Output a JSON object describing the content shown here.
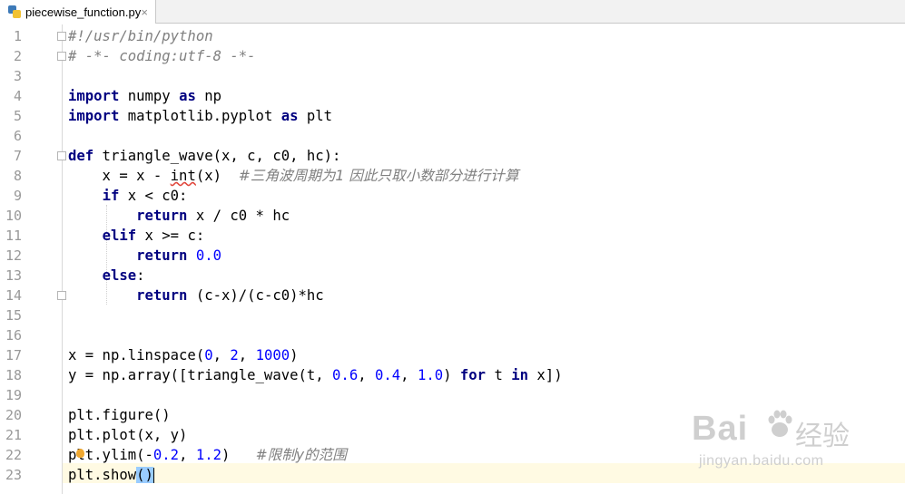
{
  "tab": {
    "filename": "piecewise_function.py",
    "close": "×"
  },
  "lines": [
    {
      "n": "1",
      "segs": [
        {
          "t": "#!/usr/bin/python",
          "c": "cm"
        }
      ]
    },
    {
      "n": "2",
      "segs": [
        {
          "t": "# -*- coding:utf-8 -*-",
          "c": "cm"
        }
      ]
    },
    {
      "n": "3",
      "segs": []
    },
    {
      "n": "4",
      "segs": [
        {
          "t": "import",
          "c": "kw"
        },
        {
          "t": " numpy "
        },
        {
          "t": "as",
          "c": "kw"
        },
        {
          "t": " np"
        }
      ]
    },
    {
      "n": "5",
      "segs": [
        {
          "t": "import",
          "c": "kw"
        },
        {
          "t": " matplotlib.pyplot "
        },
        {
          "t": "as",
          "c": "kw"
        },
        {
          "t": " plt"
        }
      ]
    },
    {
      "n": "6",
      "segs": []
    },
    {
      "n": "7",
      "segs": [
        {
          "t": "def",
          "c": "kw"
        },
        {
          "t": " triangle_wave(x, c, c0, hc):"
        }
      ]
    },
    {
      "n": "8",
      "segs": [
        {
          "t": "    x = x - "
        },
        {
          "t": "int",
          "c": "squig"
        },
        {
          "t": "(x)  "
        },
        {
          "t": "#三角波周期为1 因此只取小数部分进行计算",
          "c": "cmz"
        }
      ]
    },
    {
      "n": "9",
      "segs": [
        {
          "t": "    "
        },
        {
          "t": "if",
          "c": "kw"
        },
        {
          "t": " x < c0:"
        }
      ]
    },
    {
      "n": "10",
      "segs": [
        {
          "t": "        "
        },
        {
          "t": "return",
          "c": "kw"
        },
        {
          "t": " x / c0 * hc"
        }
      ]
    },
    {
      "n": "11",
      "segs": [
        {
          "t": "    "
        },
        {
          "t": "elif",
          "c": "kw"
        },
        {
          "t": " x >= c:"
        }
      ]
    },
    {
      "n": "12",
      "segs": [
        {
          "t": "        "
        },
        {
          "t": "return",
          "c": "kw"
        },
        {
          "t": " "
        },
        {
          "t": "0.0",
          "c": "num"
        }
      ]
    },
    {
      "n": "13",
      "segs": [
        {
          "t": "    "
        },
        {
          "t": "else",
          "c": "kw"
        },
        {
          "t": ":"
        }
      ]
    },
    {
      "n": "14",
      "segs": [
        {
          "t": "        "
        },
        {
          "t": "return",
          "c": "kw"
        },
        {
          "t": " (c-x)/(c-c0)*hc"
        }
      ]
    },
    {
      "n": "15",
      "segs": []
    },
    {
      "n": "16",
      "segs": []
    },
    {
      "n": "17",
      "segs": [
        {
          "t": "x = np.linspace("
        },
        {
          "t": "0",
          "c": "num"
        },
        {
          "t": ", "
        },
        {
          "t": "2",
          "c": "num"
        },
        {
          "t": ", "
        },
        {
          "t": "1000",
          "c": "num"
        },
        {
          "t": ")"
        }
      ]
    },
    {
      "n": "18",
      "segs": [
        {
          "t": "y = np.array([triangle_wave(t, "
        },
        {
          "t": "0.6",
          "c": "num"
        },
        {
          "t": ", "
        },
        {
          "t": "0.4",
          "c": "num"
        },
        {
          "t": ", "
        },
        {
          "t": "1.0",
          "c": "num"
        },
        {
          "t": ") "
        },
        {
          "t": "for",
          "c": "kw"
        },
        {
          "t": " t "
        },
        {
          "t": "in",
          "c": "kw"
        },
        {
          "t": " x])"
        }
      ]
    },
    {
      "n": "19",
      "segs": []
    },
    {
      "n": "20",
      "segs": [
        {
          "t": "plt.figure()"
        }
      ]
    },
    {
      "n": "21",
      "segs": [
        {
          "t": "plt.plot(x, y)"
        }
      ]
    },
    {
      "n": "22",
      "segs": [
        {
          "t": "plt.ylim(-"
        },
        {
          "t": "0.2",
          "c": "num"
        },
        {
          "t": ", "
        },
        {
          "t": "1.2",
          "c": "num"
        },
        {
          "t": ")   "
        },
        {
          "t": "#限制y的范围",
          "c": "cmz"
        }
      ]
    },
    {
      "n": "23",
      "segs": [
        {
          "t": "plt.show"
        },
        {
          "t": "()",
          "c": "match"
        },
        {
          "caret": true
        }
      ]
    }
  ],
  "watermark": {
    "brand": "Bai",
    "brand2": "经验",
    "url": "jingyan.baidu.com"
  },
  "colors": {
    "keyword": "#000080",
    "number": "#0000ff",
    "comment": "#808080",
    "caret_line": "#fffae3",
    "brace_match": "#99ccff"
  }
}
